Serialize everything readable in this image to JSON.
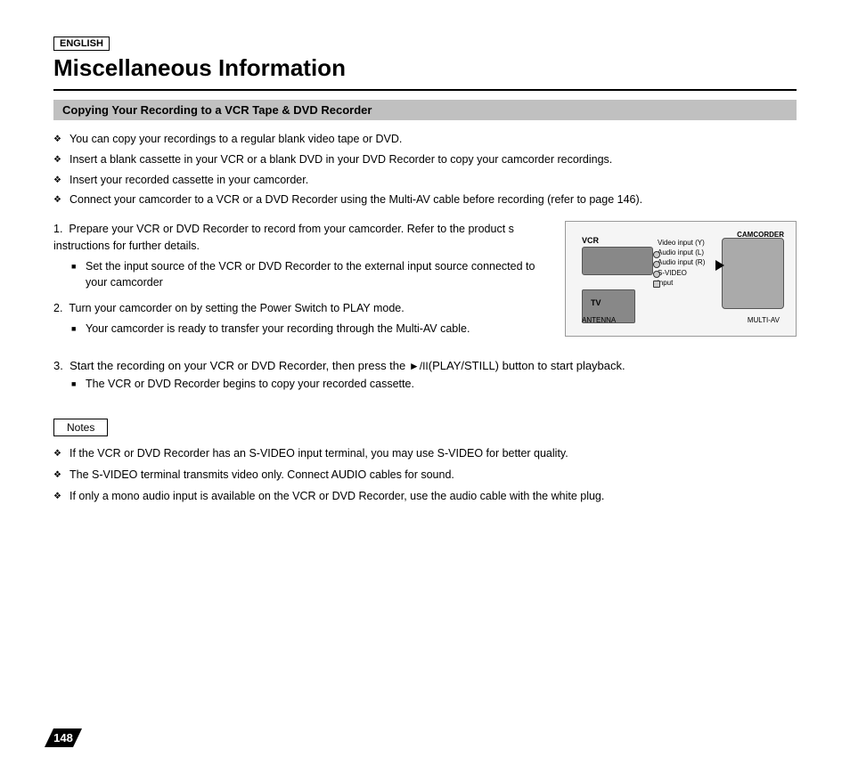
{
  "page": {
    "lang_badge": "ENGLISH",
    "title": "Miscellaneous Information",
    "section_header": "Copying Your Recording to a VCR Tape & DVD Recorder",
    "bullets": [
      "You can copy your recordings to a regular blank video tape or DVD.",
      "Insert a blank cassette in your VCR or a blank DVD in your DVD Recorder to copy your camcorder recordings.",
      "Insert your recorded cassette in your camcorder.",
      "Connect your camcorder to a VCR or a DVD Recorder using the Multi-AV cable before recording (refer to page 146)."
    ],
    "steps": [
      {
        "num": "1.",
        "text": "Prepare your VCR or DVD Recorder to record from your camcorder. Refer to the product s instructions for further details.",
        "sub": [
          "Set the input source of the VCR or DVD Recorder to the external input source connected to your camcorder"
        ]
      },
      {
        "num": "2.",
        "text": "Turn your camcorder on by setting the Power Switch to PLAY mode.",
        "sub": [
          "Your camcorder is ready to transfer your recording through the Multi-AV cable."
        ]
      }
    ],
    "step3": {
      "num": "3.",
      "text_before": "Start the recording on your VCR or DVD Recorder, then press the ",
      "play_icon": "►/II",
      "text_middle": "(PLAY/STILL) button to start playback.",
      "sub": [
        "The VCR or DVD Recorder begins to copy your recorded cassette."
      ]
    },
    "diagram": {
      "vcr_label": "VCR",
      "tv_label": "TV",
      "camcorder_label": "CAMCORDER",
      "antenna_label": "ANTENNA",
      "multiav_label": "MULTI-AV",
      "connector_labels": [
        "Video input (Y)",
        "Audio input (L)",
        "Audio input (R)",
        "S-VIDEO",
        "input"
      ]
    },
    "notes": {
      "badge": "Notes",
      "items": [
        "If the VCR or DVD Recorder has an S-VIDEO input terminal, you may use S-VIDEO for better quality.",
        "The S-VIDEO terminal transmits video only. Connect AUDIO cables for sound.",
        "If only a mono audio input is available on the VCR or DVD Recorder, use the audio cable with the white plug."
      ]
    },
    "page_number": "148"
  }
}
